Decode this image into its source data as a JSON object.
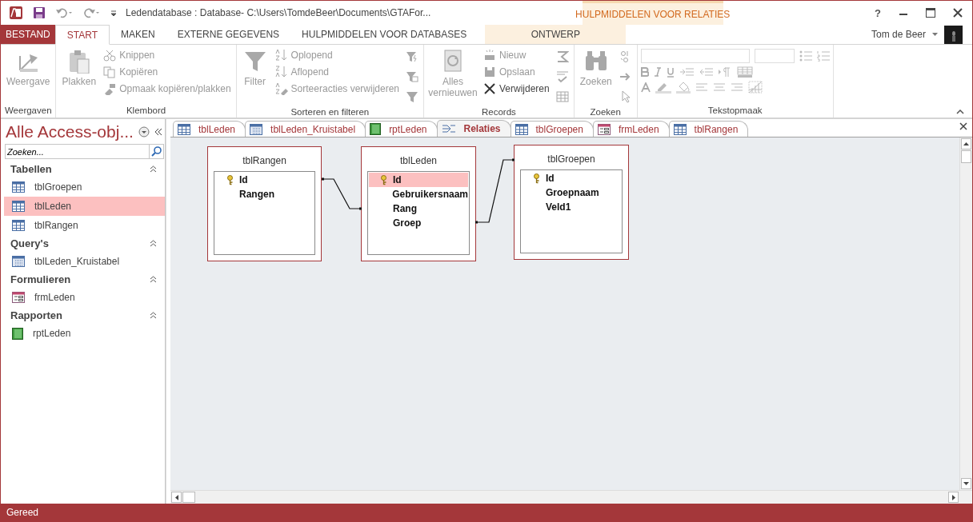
{
  "title_bar": {
    "title": "Ledendatabase : Database- C:\\Users\\TomdeBeer\\Documents\\GTAFor...",
    "context_header": "HULPMIDDELEN VOOR RELATIES",
    "help": "?"
  },
  "ribbon_tabs": [
    {
      "label": "BESTAND",
      "kind": "file",
      "selected": false
    },
    {
      "label": "START",
      "kind": "normal",
      "selected": true
    },
    {
      "label": "MAKEN",
      "kind": "normal",
      "selected": false
    },
    {
      "label": "EXTERNE GEGEVENS",
      "kind": "normal",
      "selected": false
    },
    {
      "label": "HULPMIDDELEN VOOR DATABASES",
      "kind": "normal",
      "selected": false
    },
    {
      "label": "ONTWERP",
      "kind": "contextual",
      "selected": false
    }
  ],
  "user": {
    "name": "Tom de Beer"
  },
  "ribbon_groups": [
    {
      "label": "Weergaven",
      "kind": "standard",
      "items": [
        {
          "label": "Weergave",
          "kind": "large",
          "disabled": true
        }
      ]
    },
    {
      "label": "Klembord",
      "kind": "standard",
      "items": [
        {
          "label": "Plakken",
          "kind": "large",
          "disabled": true
        },
        {
          "label": "Knippen",
          "kind": "small",
          "disabled": true
        },
        {
          "label": "Kopiëren",
          "kind": "small",
          "disabled": true
        },
        {
          "label": "Opmaak kopiëren/plakken",
          "kind": "small",
          "disabled": true
        }
      ]
    },
    {
      "label": "Sorteren en filteren",
      "kind": "standard",
      "items": [
        {
          "label": "Filter",
          "kind": "large",
          "disabled": true
        },
        {
          "label": "Oplopend",
          "kind": "small",
          "disabled": true
        },
        {
          "label": "Aflopend",
          "kind": "small",
          "disabled": true
        },
        {
          "label": "Sorteeracties verwijderen",
          "kind": "small",
          "disabled": true
        }
      ]
    },
    {
      "label": "Records",
      "kind": "standard",
      "items": [
        {
          "label": "Alles vernieuwen",
          "kind": "large",
          "disabled": true
        },
        {
          "label": "Nieuw",
          "kind": "small",
          "disabled": true
        },
        {
          "label": "Opslaan",
          "kind": "small",
          "disabled": true
        },
        {
          "label": "Verwijderen",
          "kind": "small",
          "disabled": false
        }
      ]
    },
    {
      "label": "Zoeken",
      "kind": "standard",
      "items": [
        {
          "label": "Zoeken",
          "kind": "large",
          "disabled": true
        }
      ]
    },
    {
      "label": "Tekstopmaak",
      "kind": "format"
    }
  ],
  "nav_pane": {
    "title": "Alle Access-obj...",
    "search": {
      "placeholder": "Zoeken..."
    },
    "groups": [
      {
        "label": "Tabellen",
        "items": [
          {
            "label": "tblGroepen",
            "kind": "table",
            "selected": false
          },
          {
            "label": "tblLeden",
            "kind": "table",
            "selected": true
          },
          {
            "label": "tblRangen",
            "kind": "table",
            "selected": false
          }
        ]
      },
      {
        "label": "Query's",
        "items": [
          {
            "label": "tblLeden_Kruistabel",
            "kind": "query",
            "selected": false
          }
        ]
      },
      {
        "label": "Formulieren",
        "items": [
          {
            "label": "frmLeden",
            "kind": "form",
            "selected": false
          }
        ]
      },
      {
        "label": "Rapporten",
        "items": [
          {
            "label": "rptLeden",
            "kind": "report",
            "selected": false
          }
        ]
      }
    ]
  },
  "doc_tabs": [
    {
      "label": "tblLeden",
      "kind": "table",
      "selected": false
    },
    {
      "label": "tblLeden_Kruistabel",
      "kind": "query",
      "selected": false
    },
    {
      "label": "rptLeden",
      "kind": "report",
      "selected": false
    },
    {
      "label": "Relaties",
      "kind": "relations",
      "selected": true
    },
    {
      "label": "tblGroepen",
      "kind": "table",
      "selected": false
    },
    {
      "label": "frmLeden",
      "kind": "form",
      "selected": false
    },
    {
      "label": "tblRangen",
      "kind": "table",
      "selected": false
    }
  ],
  "relationship_tables": [
    {
      "title": "tblRangen",
      "fields": [
        {
          "name": "Id",
          "key": true,
          "selected": false
        },
        {
          "name": "Rangen",
          "key": false,
          "selected": false
        }
      ]
    },
    {
      "title": "tblLeden",
      "fields": [
        {
          "name": "Id",
          "key": true,
          "selected": true
        },
        {
          "name": "Gebruikersnaam",
          "key": false,
          "selected": false
        },
        {
          "name": "Rang",
          "key": false,
          "selected": false
        },
        {
          "name": "Groep",
          "key": false,
          "selected": false
        }
      ]
    },
    {
      "title": "tblGroepen",
      "fields": [
        {
          "name": "Id",
          "key": true,
          "selected": false
        },
        {
          "name": "Groepnaam",
          "key": false,
          "selected": false
        },
        {
          "name": "Veld1",
          "key": false,
          "selected": false
        }
      ]
    }
  ],
  "status_bar": {
    "text": "Gereed"
  }
}
